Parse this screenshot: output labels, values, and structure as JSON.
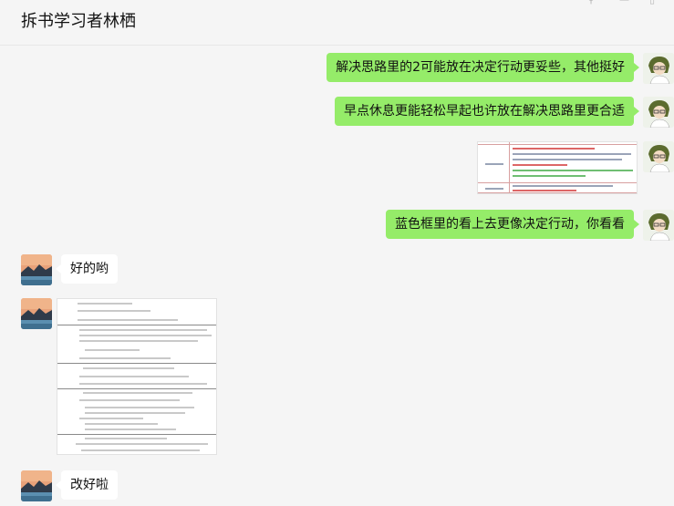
{
  "chat": {
    "title": "拆书学习者林栖"
  },
  "messages": [
    {
      "side": "right",
      "type": "text",
      "text": "解决思路里的2可能放在决定行动更妥些，其他挺好"
    },
    {
      "side": "right",
      "type": "text",
      "text": "早点休息更能轻松早起也许放在解决思路里更合适"
    },
    {
      "side": "right",
      "type": "image",
      "description_icon": "table-screenshot"
    },
    {
      "side": "right",
      "type": "text",
      "text": "蓝色框里的看上去更像决定行动，你看看"
    },
    {
      "side": "left",
      "type": "text",
      "text": "好的哟"
    },
    {
      "side": "left",
      "type": "image",
      "description_icon": "document-screenshot"
    },
    {
      "side": "left",
      "type": "text",
      "text": "改好啦"
    }
  ],
  "icons": {
    "pin": "pin-icon",
    "minimize": "minimize-icon",
    "maximize": "maximize-icon",
    "self_avatar": "cartoon-avatar-icon",
    "contact_avatar": "landscape-avatar-icon"
  },
  "colors": {
    "outgoing_bubble": "#95ec69",
    "incoming_bubble": "#ffffff",
    "background": "#f5f5f5"
  }
}
